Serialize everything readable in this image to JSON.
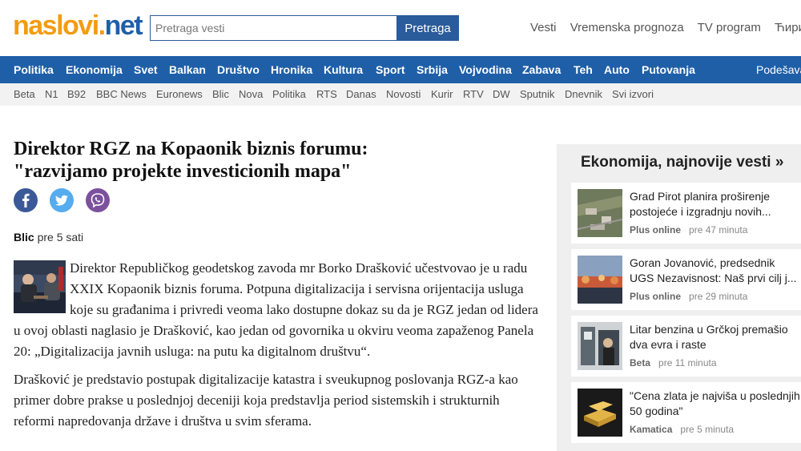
{
  "header": {
    "logo_part1": "naslovi",
    "logo_part2": "net",
    "search_placeholder": "Pretraga vesti",
    "search_button": "Pretraga",
    "top_links": [
      "Vesti",
      "Vremenska prognoza",
      "TV program",
      "Ћирили"
    ]
  },
  "nav": {
    "items": [
      "Politika",
      "Ekonomija",
      "Svet",
      "Balkan",
      "Društvo",
      "Hronika",
      "Kultura",
      "Sport",
      "Srbija",
      "Vojvodina",
      "Zabava",
      "Teh",
      "Auto",
      "Putovanja"
    ],
    "settings": "Podešava"
  },
  "sources": [
    "Beta",
    "N1",
    "B92",
    "BBC News",
    "Euronews",
    "Blic",
    "Nova",
    "Politika",
    "RTS",
    "Danas",
    "Novosti",
    "Kurir",
    "RTV",
    "DW",
    "Sputnik",
    "Dnevnik",
    "Svi izvori"
  ],
  "article": {
    "title_line1": "Direktor RGZ na Kopaonik biznis forumu:",
    "title_line2": "\"razvijamo projekte investicionih mapa\"",
    "source": "Blic",
    "time": "pre 5 sati",
    "paragraph1": "Direktor Republičkog geodetskog zavoda mr Borko Drašković učestvovao je u radu XXIX Kopaonik biznis foruma. Potpuna digitalizacija i servisna orijentacija usluga koje su građanima i privredi veoma lako dostupne dokaz su da je RGZ jedan od lidera u ovoj oblasti naglasio je Drašković, kao jedan od govornika u okviru veoma zapaženog Panela 20: „Digitalizacija javnih usluga: na putu ka digitalnom društvu“.",
    "paragraph2": "Drašković je predstavio postupak digitalizacije katastra i sveukupnog poslovanja RGZ-a kao primer dobre prakse u poslednjoj deceniji koja predstavlja period sistemskih i strukturnih reformi napredovanja države i društva u svim sferama."
  },
  "sidebar": {
    "title": "Ekonomija, najnovije vesti »",
    "news": [
      {
        "line1": "Grad Pirot planira proširenje",
        "line2": "postojeće i izgradnju novih...",
        "source": "Plus online",
        "time": "pre 47 minuta"
      },
      {
        "line1": "Goran Jovanović, predsednik",
        "line2": "UGS Nezavisnost: Naš prvi cilj j...",
        "source": "Plus online",
        "time": "pre 29 minuta"
      },
      {
        "line1": "Litar benzina u Grčkoj premašio",
        "line2": "dva evra i raste",
        "source": "Beta",
        "time": "pre 11 minuta"
      },
      {
        "line1": "\"Cena zlata je najviša u poslednjih",
        "line2": "50 godina\"",
        "source": "Kamatica",
        "time": "pre 5 minuta"
      }
    ]
  },
  "colors": {
    "brand_blue": "#1f5fa8",
    "logo_orange": "#f39c12",
    "facebook": "#3b5998",
    "twitter": "#55acee",
    "viber": "#7b519d"
  }
}
